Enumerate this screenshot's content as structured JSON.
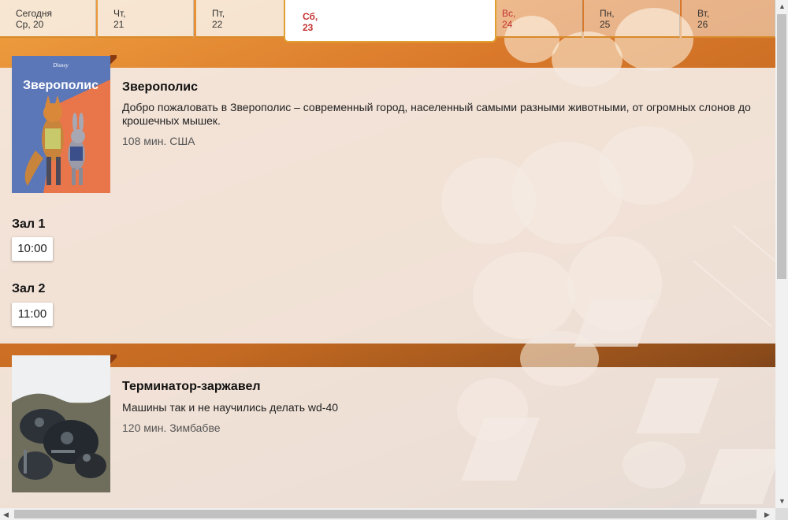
{
  "days": [
    {
      "top": "Сегодня",
      "bottom": "Ср, 20"
    },
    {
      "top": "Чт,",
      "bottom": "21"
    },
    {
      "top": "Пт,",
      "bottom": "22"
    },
    {
      "top": "Сб,",
      "bottom": "23"
    },
    {
      "top": "Вс,",
      "bottom": "24"
    },
    {
      "top": "Пн,",
      "bottom": "25"
    },
    {
      "top": "Вт,",
      "bottom": "26"
    }
  ],
  "movies": [
    {
      "poster_text": "Зверополис",
      "poster_brand": "Disney",
      "title": "Зверополис",
      "description": "Добро пожаловать в Зверополис – современный город, населенный самыми разными животными, от огромных слонов до крошечных мышек.",
      "meta": "108 мин. США",
      "halls": [
        {
          "name": "Зал 1",
          "time": "10:00"
        },
        {
          "name": "Зал 2",
          "time": "11:00"
        }
      ]
    },
    {
      "title": "Терминатор-заржавел",
      "description": "Машины так и не научились делать wd-40",
      "meta": "120 мин. Зимбабве"
    }
  ],
  "colors": {
    "accent": "#d88a2a",
    "weekend": "#c43232",
    "card_bg": "#f4ebe4"
  }
}
